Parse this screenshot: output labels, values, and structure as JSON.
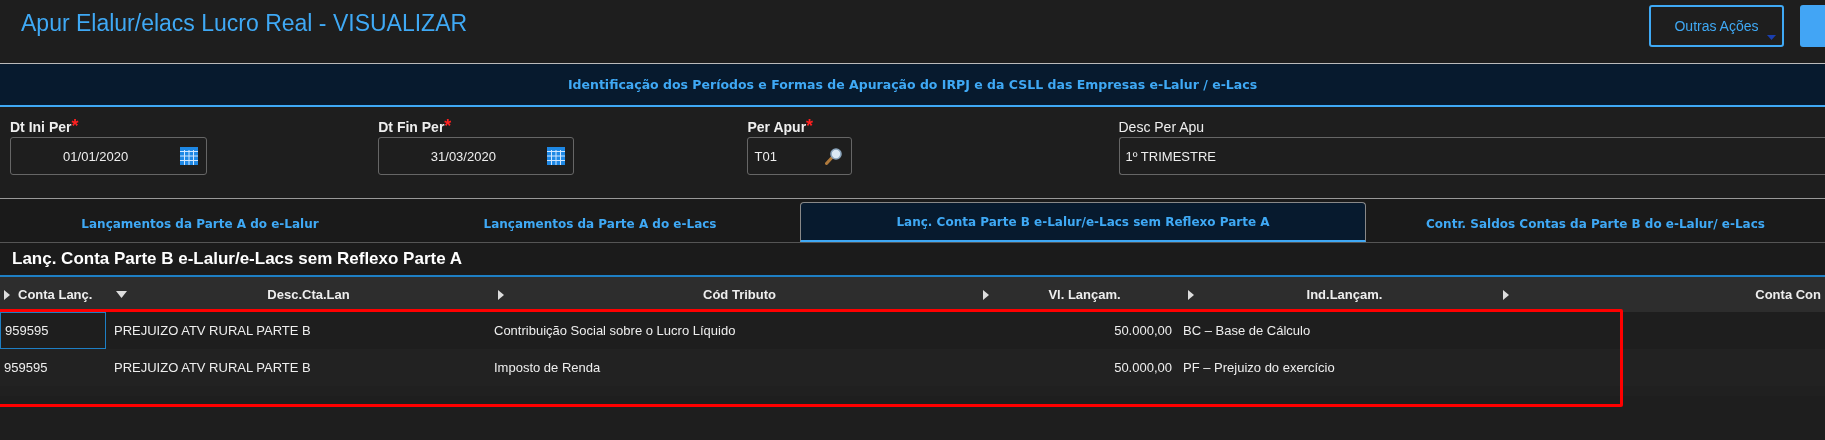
{
  "page_title": "Apur Elalur/elacs Lucro Real - VISUALIZAR",
  "actions": [
    {
      "label": "Outras Ações",
      "kind": "outline"
    },
    {
      "kind": "primary"
    }
  ],
  "section_header": "Identificação dos Períodos e Formas de Apuração do IRPJ e da CSLL das Empresas e-Lalur / e-Lacs",
  "fields": [
    {
      "label": "Dt Ini Per",
      "required_mark": "*",
      "value": "01/01/2020",
      "kind": "date"
    },
    {
      "label": "Dt Fin Per",
      "required_mark": "*",
      "value": "31/03/2020",
      "kind": "date"
    },
    {
      "label": "Per Apur",
      "required_mark": "*",
      "value": "T01",
      "kind": "lookup"
    },
    {
      "label": "Desc Per Apu",
      "value": "1º TRIMESTRE",
      "kind": "text"
    }
  ],
  "tabs": [
    {
      "label": "Lançamentos da Parte A do e-Lalur",
      "selected": false
    },
    {
      "label": "Lançamentos da Parte A do e-Lacs",
      "selected": false
    },
    {
      "label": "Lanç. Conta Parte B e-Lalur/e-Lacs sem Reflexo Parte A",
      "selected": true
    },
    {
      "label": "Contr. Saldos Contas da Parte B do e-Lalur/ e-Lacs",
      "selected": false
    }
  ],
  "grid": {
    "title": "Lanç. Conta Parte B e-Lalur/e-Lacs sem Reflexo Parte A",
    "highlighted": true,
    "columns": [
      {
        "label": "Conta Lanç.",
        "expanded": false
      },
      {
        "label": "Desc.Cta.Lan",
        "expanded": true
      },
      {
        "label": "Cód Tributo",
        "expanded": false
      },
      {
        "label": "Vl. Lançam.",
        "expanded": false
      },
      {
        "label": "Ind.Lançam.",
        "expanded": false
      },
      {
        "label": "Conta Con",
        "expanded": false
      }
    ],
    "rows": [
      {
        "focused": true,
        "cells": [
          "959595",
          "PREJUIZO ATV RURAL PARTE B",
          "Contribuição Social sobre o Lucro Líquido",
          "50.000,00",
          "BC – Base de Cálculo"
        ]
      },
      {
        "focused": false,
        "cells": [
          "959595",
          "PREJUIZO ATV RURAL PARTE B",
          "Imposto de Renda",
          "50.000,00",
          "PF – Prejuizo do exercício"
        ]
      }
    ]
  }
}
